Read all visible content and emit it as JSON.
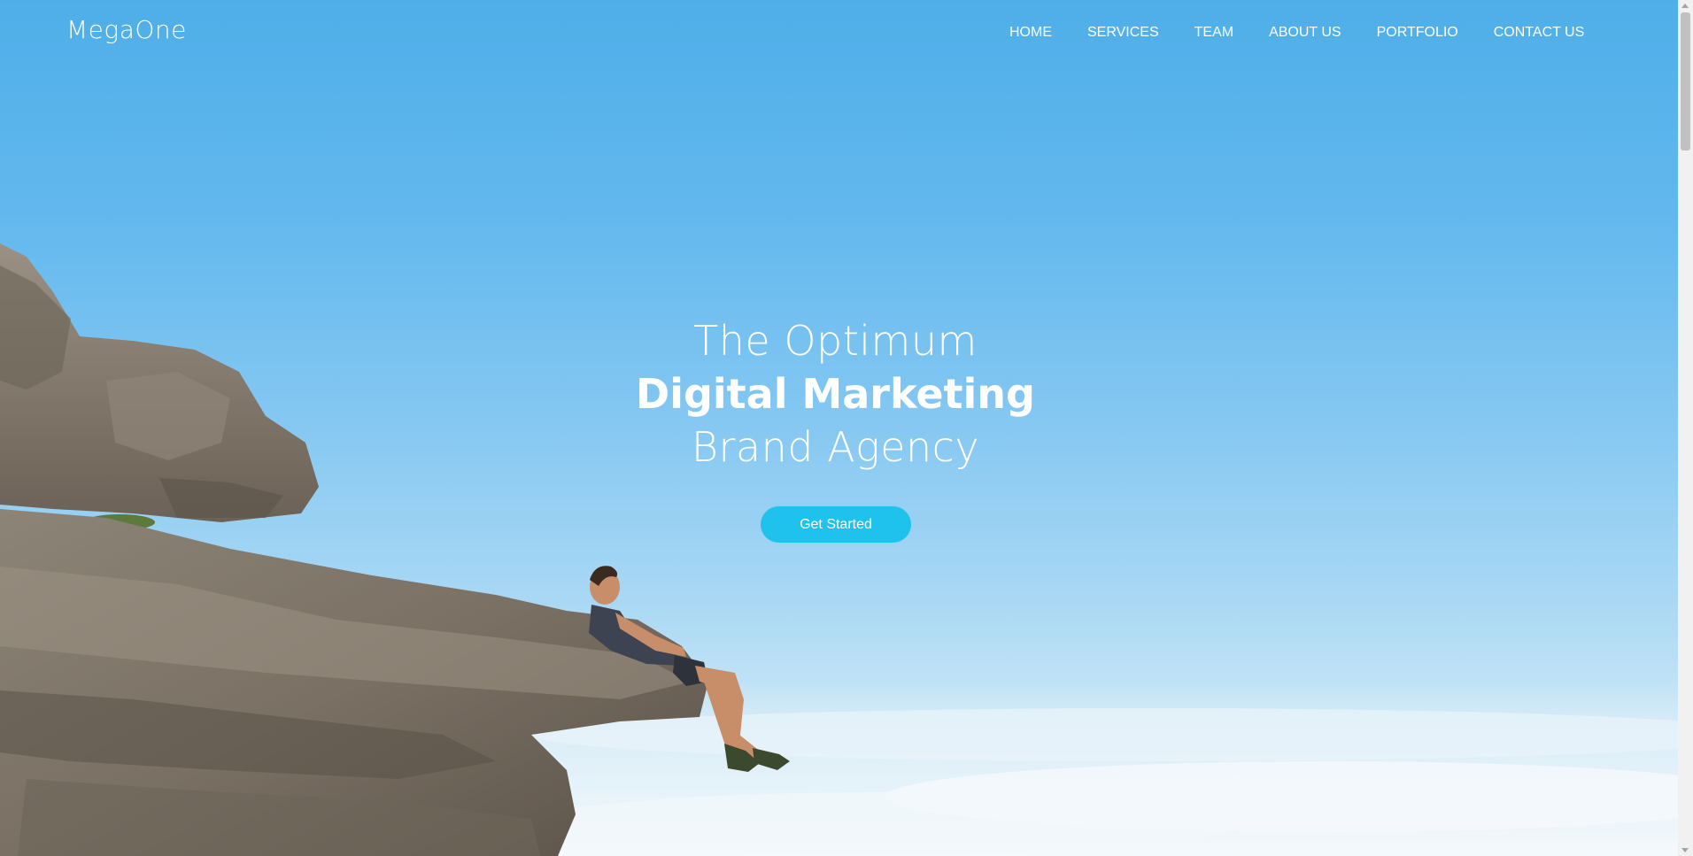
{
  "brand": {
    "logo_text": "MegaOne"
  },
  "nav": {
    "items": [
      {
        "label": "HOME"
      },
      {
        "label": "SERVICES"
      },
      {
        "label": "TEAM"
      },
      {
        "label": "ABOUT US"
      },
      {
        "label": "PORTFOLIO"
      },
      {
        "label": "CONTACT US"
      }
    ]
  },
  "hero": {
    "line1": "The Optimum",
    "line2": "Digital Marketing",
    "line3": "Brand Agency",
    "cta_label": "Get Started",
    "image": "man sitting on a rocky cliff edge above the clouds"
  },
  "colors": {
    "accent": "#1fc2ec",
    "sky_top": "#4faee8",
    "sky_bottom": "#e3f0f8",
    "text": "#ffffff"
  }
}
